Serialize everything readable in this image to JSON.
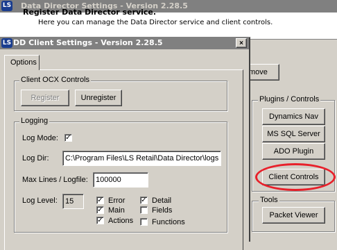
{
  "background_window": {
    "title": "Data Director Settings - Version 2.28.5",
    "header_title": "Register Data Director service.",
    "header_subtitle": "Here you can manage the Data Director service and client controls.",
    "remove_button": "move",
    "plugins_group": {
      "label": "Plugins / Controls",
      "buttons": [
        "Dynamics Nav",
        "MS SQL Server",
        "ADO Plugin",
        "Client Controls"
      ]
    },
    "tools_group": {
      "label": "Tools",
      "buttons": [
        "Packet Viewer"
      ]
    }
  },
  "dialog": {
    "title": "DD Client Settings - Version 2.28.5",
    "close_glyph": "×",
    "tabs": [
      "Options"
    ],
    "ocx_group": {
      "label": "Client OCX Controls",
      "register_label": "Register",
      "unregister_label": "Unregister"
    },
    "logging_group": {
      "label": "Logging",
      "log_mode_label": "Log Mode:",
      "log_mode_checked": true,
      "log_dir_label": "Log Dir:",
      "log_dir_value": "C:\\Program Files\\LS Retail\\Data Director\\logs",
      "max_lines_label": "Max Lines / Logfile:",
      "max_lines_value": "100000",
      "log_level_label": "Log Level:",
      "log_level_value": "15",
      "checks": [
        {
          "label": "Error",
          "checked": true
        },
        {
          "label": "Main",
          "checked": true
        },
        {
          "label": "Actions",
          "checked": true
        },
        {
          "label": "Detail",
          "checked": true
        },
        {
          "label": "Fields",
          "checked": false
        },
        {
          "label": "Functions",
          "checked": false
        }
      ]
    }
  },
  "colors": {
    "window_face": "#d4d0c8",
    "inactive_titlebar": "#808080",
    "highlight_ellipse": "#e8202a"
  }
}
